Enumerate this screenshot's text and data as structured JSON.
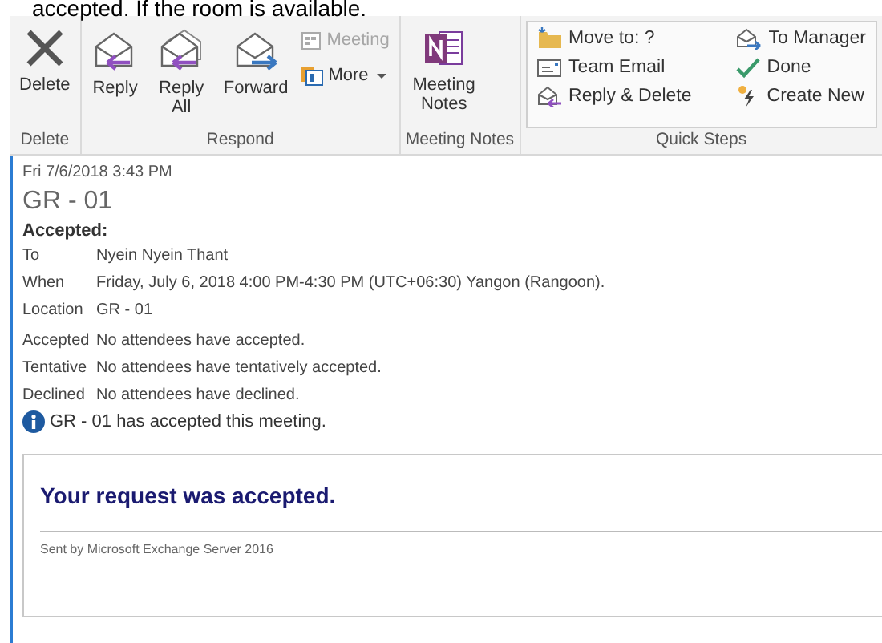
{
  "caption": "accepted.  If the room is available.",
  "ribbon": {
    "groups": [
      {
        "label": "Delete",
        "items": [
          {
            "kind": "delete",
            "label": "Delete",
            "disabled": false
          }
        ]
      },
      {
        "label": "Respond",
        "items": [
          {
            "kind": "reply",
            "label": "Reply",
            "disabled": false
          },
          {
            "kind": "reply-all",
            "label": "Reply All",
            "disabled": false
          },
          {
            "kind": "forward",
            "label": "Forward",
            "disabled": false
          },
          {
            "kind": "meeting",
            "label": "Meeting",
            "disabled": true
          },
          {
            "kind": "more",
            "label": "More",
            "disabled": false
          }
        ]
      },
      {
        "label": "Meeting Notes",
        "items": [
          {
            "kind": "onenote",
            "label": "Meeting Notes",
            "disabled": false
          }
        ]
      }
    ],
    "quick_steps": {
      "label": "Quick Steps",
      "items": [
        {
          "kind": "move",
          "label": "Move to: ?"
        },
        {
          "kind": "team-email",
          "label": "Team Email"
        },
        {
          "kind": "reply-delete",
          "label": "Reply & Delete"
        },
        {
          "kind": "to-manager",
          "label": "To Manager"
        },
        {
          "kind": "done",
          "label": "Done"
        },
        {
          "kind": "create-new",
          "label": "Create New"
        }
      ]
    }
  },
  "message": {
    "date": "Fri 7/6/2018 3:43 PM",
    "subject": "GR - 01",
    "status": "Accepted:",
    "fields": [
      {
        "label": "To",
        "value": "Nyein Nyein Thant"
      },
      {
        "label": "When",
        "value": "Friday, July 6, 2018 4:00 PM-4:30 PM (UTC+06:30) Yangon (Rangoon)."
      },
      {
        "label": "Location",
        "value": "GR - 01"
      }
    ],
    "responses": [
      {
        "label": "Accepted",
        "value": "No attendees have accepted."
      },
      {
        "label": "Tentative",
        "value": "No attendees have tentatively accepted."
      },
      {
        "label": "Declined",
        "value": "No attendees have declined."
      }
    ],
    "info": "GR - 01 has accepted this meeting.",
    "body": {
      "heading": "Your request was accepted.",
      "footer": "Sent by Microsoft Exchange Server 2016"
    }
  }
}
